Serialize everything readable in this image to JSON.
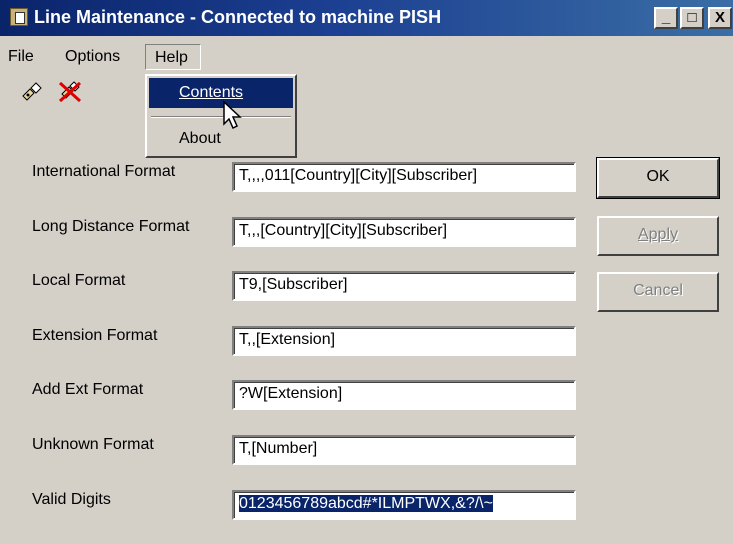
{
  "window": {
    "title": "Line Maintenance - Connected to machine PISH",
    "min_glyph": "_",
    "max_glyph": "□",
    "close_glyph": "X"
  },
  "menubar": {
    "file": "File",
    "options": "Options",
    "help": "Help"
  },
  "help_menu": {
    "contents": "Contents",
    "about": "About"
  },
  "fields": [
    {
      "label": "International Format",
      "value": "T,,,,011[Country][City][Subscriber]"
    },
    {
      "label": "Long Distance Format",
      "value": "T,,,[Country][City][Subscriber]"
    },
    {
      "label": "Local Format",
      "value": "T9,[Subscriber]"
    },
    {
      "label": "Extension Format",
      "value": "T,,[Extension]"
    },
    {
      "label": "Add Ext Format",
      "value": "?W[Extension]"
    },
    {
      "label": "Unknown Format",
      "value": "T,[Number]"
    },
    {
      "label": "Valid Digits",
      "value": "0123456789abcd#*ILMPTWX,&?/\\~"
    }
  ],
  "buttons": {
    "ok": "OK",
    "apply": "Apply",
    "cancel": "Cancel"
  },
  "icons": [
    "connect-icon",
    "disconnect-icon",
    "cursor-arrow-icon"
  ]
}
